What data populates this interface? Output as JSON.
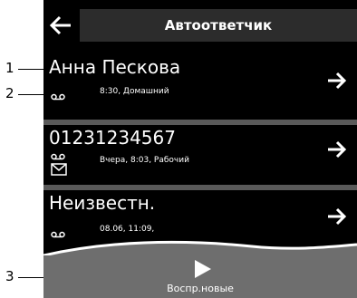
{
  "header": {
    "title": "Автоответчик"
  },
  "entries": [
    {
      "name": "Анна Пескова",
      "meta": "8:30, Домашний"
    },
    {
      "name": "01231234567",
      "meta": "Вчера, 8:03, Рабочий"
    },
    {
      "name": "Неизвестн.",
      "meta": "08.06, 11:09,"
    }
  ],
  "footer": {
    "play_label": "Воспр.новые"
  },
  "callouts": {
    "c1": "1",
    "c2": "2",
    "c3": "3"
  },
  "icons": {
    "back": "back-arrow-icon",
    "next": "right-arrow-icon",
    "voicemail": "voicemail-icon",
    "envelope": "envelope-icon",
    "play": "play-icon"
  },
  "colors": {
    "screen_bg": "#000000",
    "title_bar": "#2c2c2c",
    "separator": "#595959",
    "footer_bg": "#6e6e6e",
    "text": "#ffffff"
  }
}
